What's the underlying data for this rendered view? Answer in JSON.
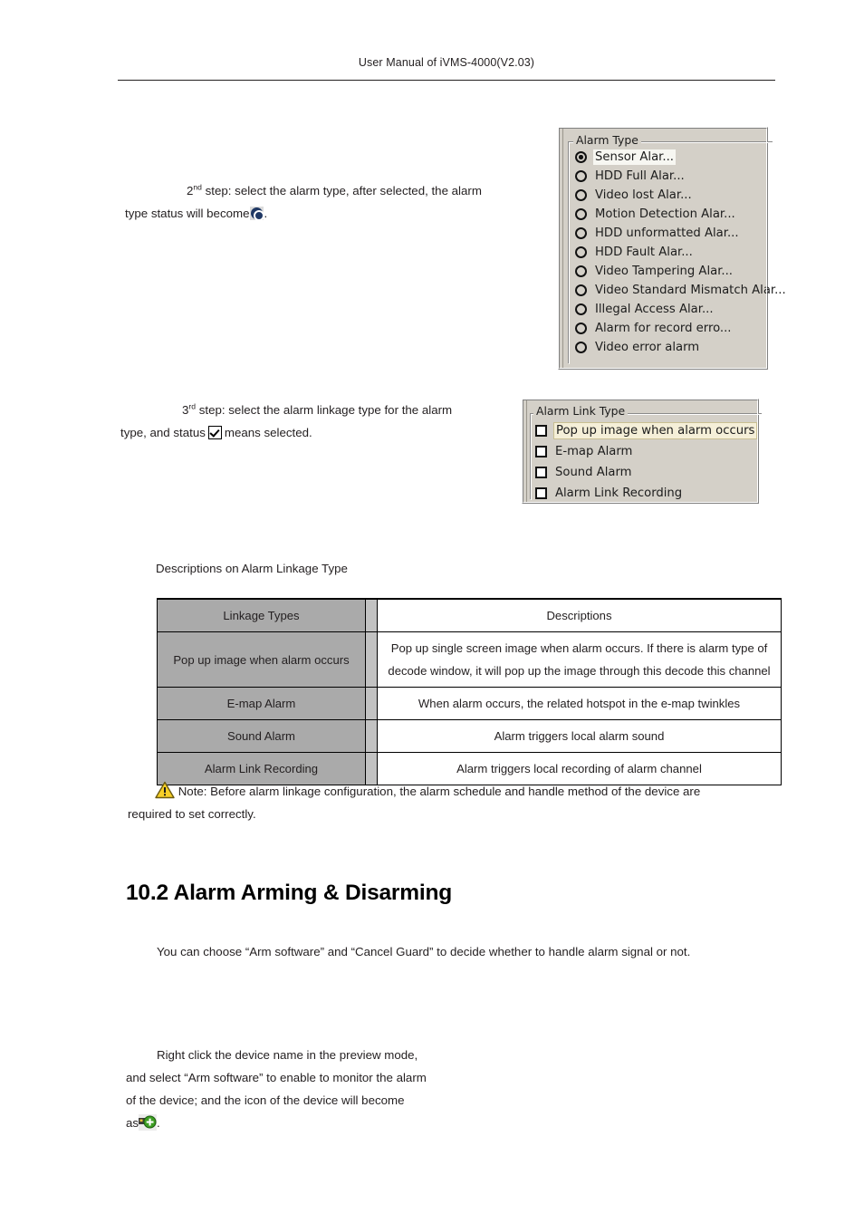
{
  "header": {
    "title": "User Manual of iVMS-4000(V2.03)"
  },
  "steps": {
    "step2_line1_a": "2",
    "step2_line1_sup": "nd",
    "step2_line1_b": " step: select the alarm type, after selected, the alarm",
    "step2_line2_a": "type status will become",
    "step2_line2_b": ".",
    "step3_line1_a": "3",
    "step3_line1_sup": "rd",
    "step3_line1_b": " step: select the alarm linkage type for the alarm",
    "step3_line2_a": "type, and status",
    "step3_line2_b": "means selected."
  },
  "alarm_type_panel": {
    "group_label": "Alarm Type",
    "options": [
      {
        "label": "Sensor Alar...",
        "selected": true
      },
      {
        "label": "HDD Full Alar...",
        "selected": false
      },
      {
        "label": "Video lost Alar...",
        "selected": false
      },
      {
        "label": "Motion Detection Alar...",
        "selected": false
      },
      {
        "label": "HDD unformatted Alar...",
        "selected": false
      },
      {
        "label": "HDD Fault Alar...",
        "selected": false
      },
      {
        "label": "Video Tampering Alar...",
        "selected": false
      },
      {
        "label": "Video Standard Mismatch Alar...",
        "selected": false
      },
      {
        "label": "Illegal Access Alar...",
        "selected": false
      },
      {
        "label": "Alarm for record erro...",
        "selected": false
      },
      {
        "label": "Video error alarm",
        "selected": false
      }
    ]
  },
  "alarm_link_panel": {
    "group_label": "Alarm Link Type",
    "options": [
      {
        "label": "Pop up image when alarm occurs",
        "checked": false,
        "highlighted": true
      },
      {
        "label": "E-map Alarm",
        "checked": false,
        "highlighted": false
      },
      {
        "label": "Sound Alarm",
        "checked": false,
        "highlighted": false
      },
      {
        "label": "Alarm Link Recording",
        "checked": false,
        "highlighted": false
      }
    ]
  },
  "table_caption": "Descriptions on Alarm Linkage Type",
  "table": {
    "headers": [
      "Linkage Types",
      "Descriptions"
    ],
    "rows": [
      {
        "type": "Pop up image when alarm occurs",
        "description": "Pop up single screen image when alarm occurs. If there is alarm type of decode window, it will pop up the image through this decode this channel"
      },
      {
        "type": "E-map Alarm",
        "description": "When alarm occurs, the related hotspot in the e-map twinkles"
      },
      {
        "type": "Sound Alarm",
        "description": "Alarm triggers local alarm sound"
      },
      {
        "type": "Alarm Link Recording",
        "description": "Alarm triggers local recording of alarm channel"
      }
    ]
  },
  "note": {
    "line1": "Note: Before alarm linkage configuration, the alarm schedule and handle method of the device are",
    "line2": "required to set correctly."
  },
  "section": {
    "heading": "10.2 Alarm Arming & Disarming",
    "intro": "You can choose “Arm software” and “Cancel Guard” to decide whether to handle alarm signal or not.",
    "body_line1": "Right click the device name in the preview mode,",
    "body_line2": "and select “Arm software” to enable to monitor the alarm",
    "body_line3": "of the device; and the icon of the device will become",
    "body_line4_a": "as",
    "body_line4_b": "."
  },
  "colors": {
    "panel_face": "#d4d0c8",
    "table_gray": "#aaaaaa",
    "highlight_cream": "#f5efd8",
    "warn_yellow": "#f7cf27",
    "arm_green": "#3d9e23",
    "radio_blue": "#1f3864"
  }
}
